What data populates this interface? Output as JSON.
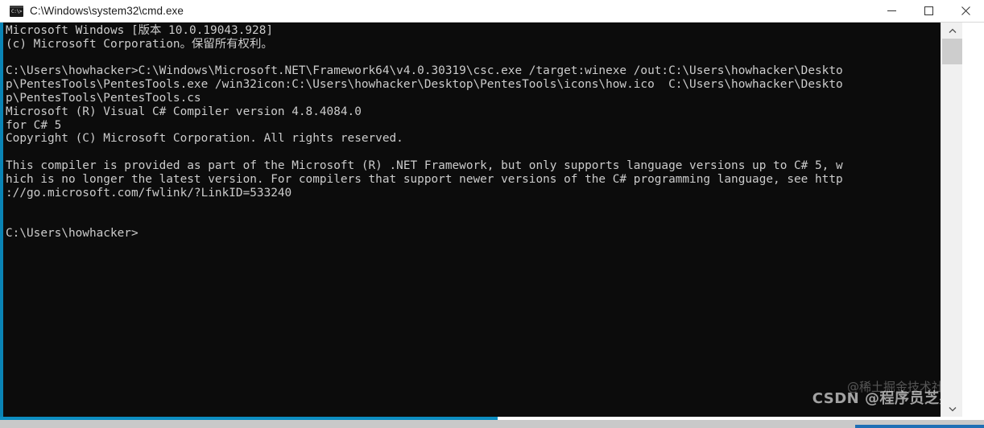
{
  "window": {
    "title": "C:\\Windows\\system32\\cmd.exe",
    "icon": "cmd-console-icon",
    "icon_prompt_text": "C:\\>",
    "controls": {
      "minimize": "minimize-button",
      "maximize": "maximize-button",
      "close": "close-button"
    }
  },
  "console": {
    "background_color": "#0c0c0c",
    "foreground_color": "#cccccc",
    "accent_color": "#0d8ec2",
    "lines": [
      "Microsoft Windows [版本 10.0.19043.928]",
      "(c) Microsoft Corporation。保留所有权利。",
      "",
      "C:\\Users\\howhacker>C:\\Windows\\Microsoft.NET\\Framework64\\v4.0.30319\\csc.exe /target:winexe /out:C:\\Users\\howhacker\\Deskto",
      "p\\PentesTools\\PentesTools.exe /win32icon:C:\\Users\\howhacker\\Desktop\\PentesTools\\icons\\how.ico  C:\\Users\\howhacker\\Deskto",
      "p\\PentesTools\\PentesTools.cs",
      "Microsoft (R) Visual C# Compiler version 4.8.4084.0",
      "for C# 5",
      "Copyright (C) Microsoft Corporation. All rights reserved.",
      "",
      "This compiler is provided as part of the Microsoft (R) .NET Framework, but only supports language versions up to C# 5, w",
      "hich is no longer the latest version. For compilers that support newer versions of the C# programming language, see http",
      "://go.microsoft.com/fwlink/?LinkID=533240",
      "",
      "",
      "C:\\Users\\howhacker>"
    ]
  },
  "scrollbar": {
    "up_arrow": "scroll-up-arrow",
    "down_arrow": "scroll-down-arrow",
    "thumb": "scroll-thumb"
  },
  "watermarks": {
    "juejin": "@稀土掘金技术社区",
    "csdn": "CSDN @程序员芝兆"
  }
}
